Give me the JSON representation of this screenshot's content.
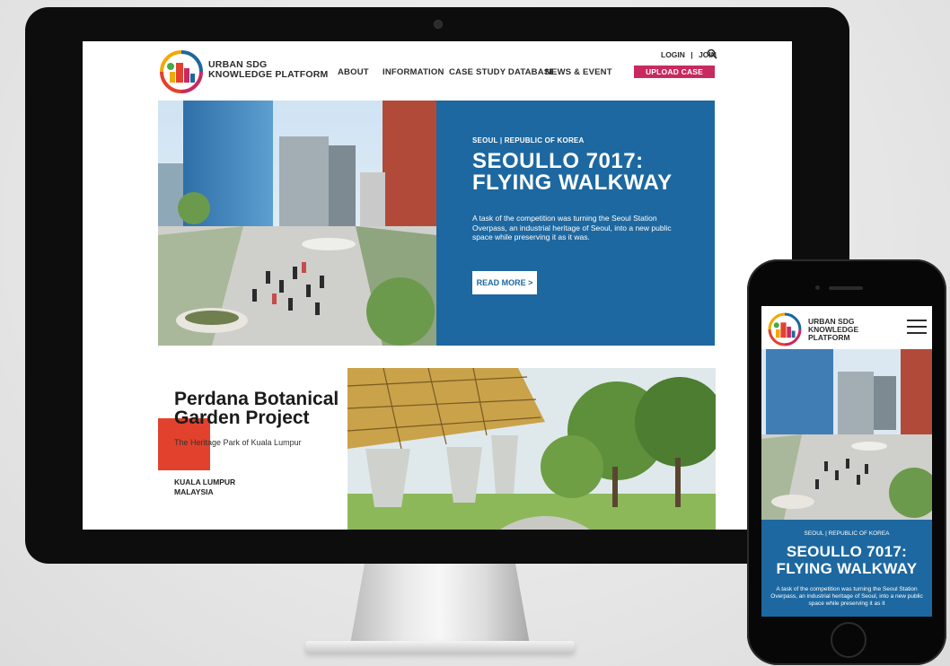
{
  "site": {
    "brand_line1": "URBAN SDG",
    "brand_line2": "KNOWLEDGE PLATFORM",
    "logo_icon": "city-skyline-ring-icon"
  },
  "nav": {
    "items": [
      "ABOUT",
      "INFORMATION",
      "CASE STUDY DATABASE",
      "NEWS & EVENT"
    ],
    "login": "LOGIN",
    "separator": "|",
    "join": "JOIN",
    "upload": "UPLOAD CASE STUDIES",
    "search_icon": "search-icon"
  },
  "hero": {
    "location": "SEOUL | REPUBLIC OF KOREA",
    "title": "SEOULLO 7017: FLYING WALKWAY",
    "description": "A task of the competition was turning the Seoul Station Overpass, an industrial heritage of Seoul, into a new public space while preserving it as it was.",
    "cta": "READ MORE >"
  },
  "feature": {
    "title": "Perdana Botanical Garden Project",
    "subtitle": "The Heritage Park of Kuala Lumpur",
    "city": "KUALA LUMPUR",
    "country": "MALAYSIA"
  },
  "mobile": {
    "brand_line1": "URBAN SDG",
    "brand_line2": "KNOWLEDGE PLATFORM",
    "location": "SEOUL | REPUBLIC OF KOREA",
    "title": "SEOULLO 7017: FLYING WALKWAY",
    "description": "A task of the competition was turning the Seoul Station Overpass, an industrial heritage of Seoul, into a new public space while preserving it as it",
    "menu_icon": "hamburger-menu-icon"
  },
  "colors": {
    "accent_blue": "#1d68a0",
    "upload_pink": "#c8295f",
    "feature_red": "#e2422d"
  }
}
